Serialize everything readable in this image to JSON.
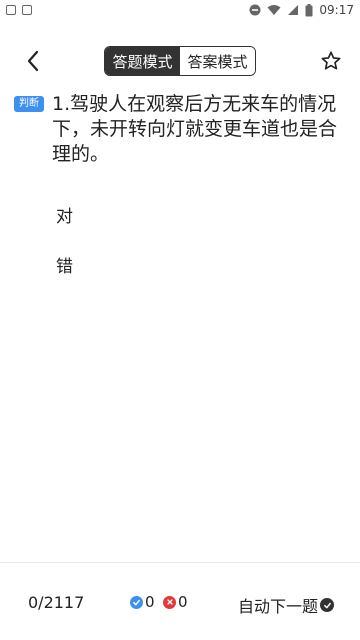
{
  "status_bar": {
    "time": "09:17"
  },
  "header": {
    "modes": [
      "答题模式",
      "答案模式"
    ],
    "active_mode": "答题模式"
  },
  "question": {
    "type_badge": "判断",
    "text": "1.驾驶人在观察后方无来车的情况下，未开转向灯就变更车道也是合理的。",
    "options": [
      "对",
      "错"
    ]
  },
  "footer": {
    "progress": "0/2117",
    "correct_count": "0",
    "wrong_count": "0",
    "auto_next_label": "自动下一题"
  },
  "colors": {
    "accent": "#3d8ff0",
    "wrong": "#e23a3a",
    "dark": "#333333"
  }
}
